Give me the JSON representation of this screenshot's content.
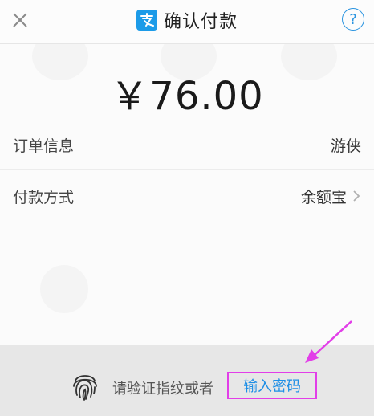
{
  "header": {
    "title": "确认付款",
    "help_symbol": "?"
  },
  "payment": {
    "amount": "￥76.00"
  },
  "rows": {
    "order_label": "订单信息",
    "order_value": "游侠",
    "method_label": "付款方式",
    "method_value": "余额宝"
  },
  "footer": {
    "prompt": "请验证指纹或者",
    "password_link": "输入密码"
  },
  "colors": {
    "alipay_blue": "#1c9be8",
    "link_blue": "#1e8fe6",
    "highlight_magenta": "#e23ee8"
  },
  "icons": [
    "close-icon",
    "alipay-logo-icon",
    "help-icon",
    "chevron-right-icon",
    "fingerprint-icon",
    "annotation-arrow"
  ]
}
